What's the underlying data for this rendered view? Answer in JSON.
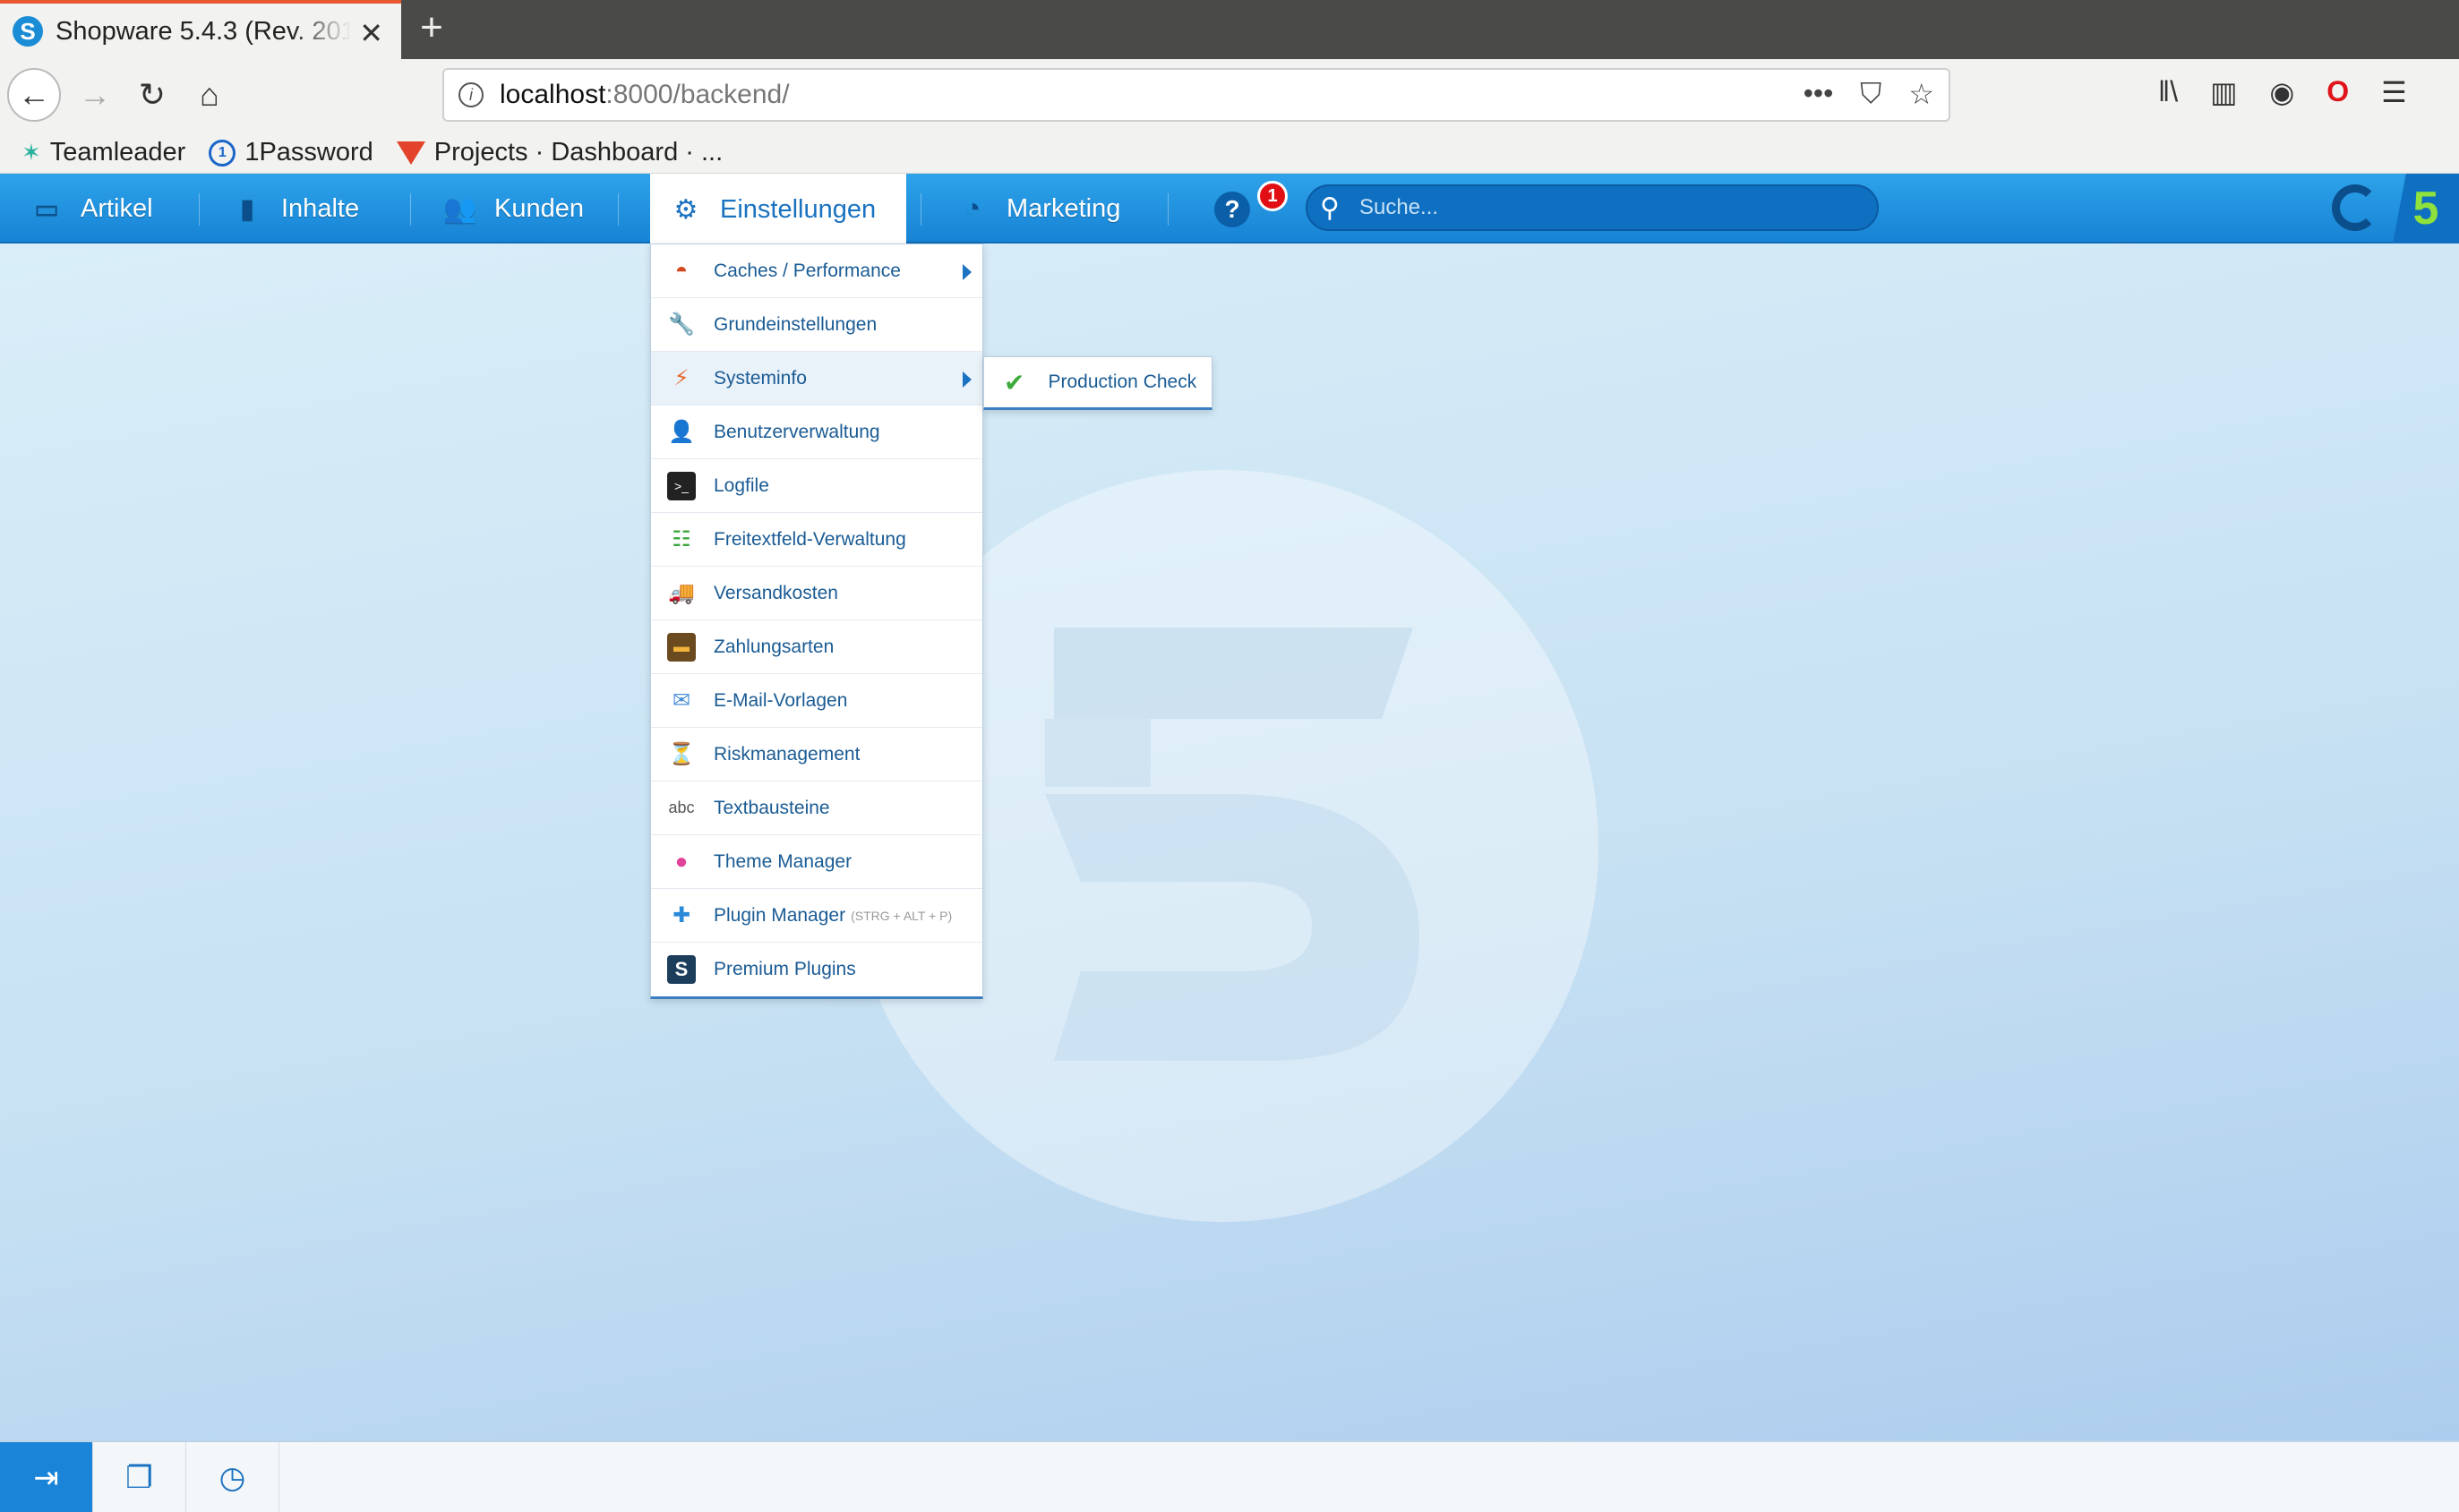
{
  "browser": {
    "tab_title": "Shopware 5.4.3 (Rev. 201",
    "tab_favicon": "shopware-favicon",
    "new_tab_label": "+",
    "url_host": "localhost",
    "url_path": ":8000/backend/",
    "url_actions": [
      "•••",
      "pocket-icon",
      "star-icon"
    ],
    "bookmarks": [
      {
        "label": "Teamleader",
        "icon": "teamleader-icon"
      },
      {
        "label": "1Password",
        "icon": "1password-icon"
      },
      {
        "label": "Projects · Dashboard · ...",
        "icon": "gitlab-icon"
      }
    ]
  },
  "header": {
    "menu": [
      {
        "label": "Artikel",
        "icon": "box-icon"
      },
      {
        "label": "Inhalte",
        "icon": "document-icon"
      },
      {
        "label": "Kunden",
        "icon": "users-icon"
      },
      {
        "label": "Einstellungen",
        "icon": "gear-icon",
        "active": true
      },
      {
        "label": "Marketing",
        "icon": "pie-chart-icon"
      }
    ],
    "help_label": "?",
    "notification_count": "1",
    "search_placeholder": "Suche...",
    "five_badge": "5"
  },
  "settings_menu": {
    "items": [
      {
        "label": "Caches / Performance",
        "icon": "speedometer-icon",
        "has_submenu": true
      },
      {
        "label": "Grundeinstellungen",
        "icon": "wrench-icon"
      },
      {
        "label": "Systeminfo",
        "icon": "lightning-icon",
        "has_submenu": true,
        "hover": true
      },
      {
        "label": "Benutzerverwaltung",
        "icon": "user-icon"
      },
      {
        "label": "Logfile",
        "icon": "terminal-icon"
      },
      {
        "label": "Freitextfeld-Verwaltung",
        "icon": "fields-add-icon"
      },
      {
        "label": "Versandkosten",
        "icon": "truck-icon"
      },
      {
        "label": "Zahlungsarten",
        "icon": "credit-card-icon"
      },
      {
        "label": "E-Mail-Vorlagen",
        "icon": "email-template-icon"
      },
      {
        "label": "Riskmanagement",
        "icon": "risk-icon"
      },
      {
        "label": "Textbausteine",
        "icon": "abc-icon"
      },
      {
        "label": "Theme Manager",
        "icon": "theme-icon"
      },
      {
        "label": "Plugin Manager",
        "hint": "(STRG + ALT + P)",
        "icon": "puzzle-icon"
      },
      {
        "label": "Premium Plugins",
        "icon": "shopware-icon"
      }
    ],
    "submenu": {
      "label": "Production Check",
      "icon": "check-icon"
    }
  },
  "taskbar": {
    "buttons": [
      {
        "icon": "logout-icon"
      },
      {
        "icon": "windows-icon"
      },
      {
        "icon": "dashboard-icon"
      }
    ]
  },
  "colors": {
    "header_blue": "#1f8fe0",
    "menu_text": "#1a5b94",
    "badge_red": "#e10f14",
    "five_green": "#8fe13b"
  }
}
